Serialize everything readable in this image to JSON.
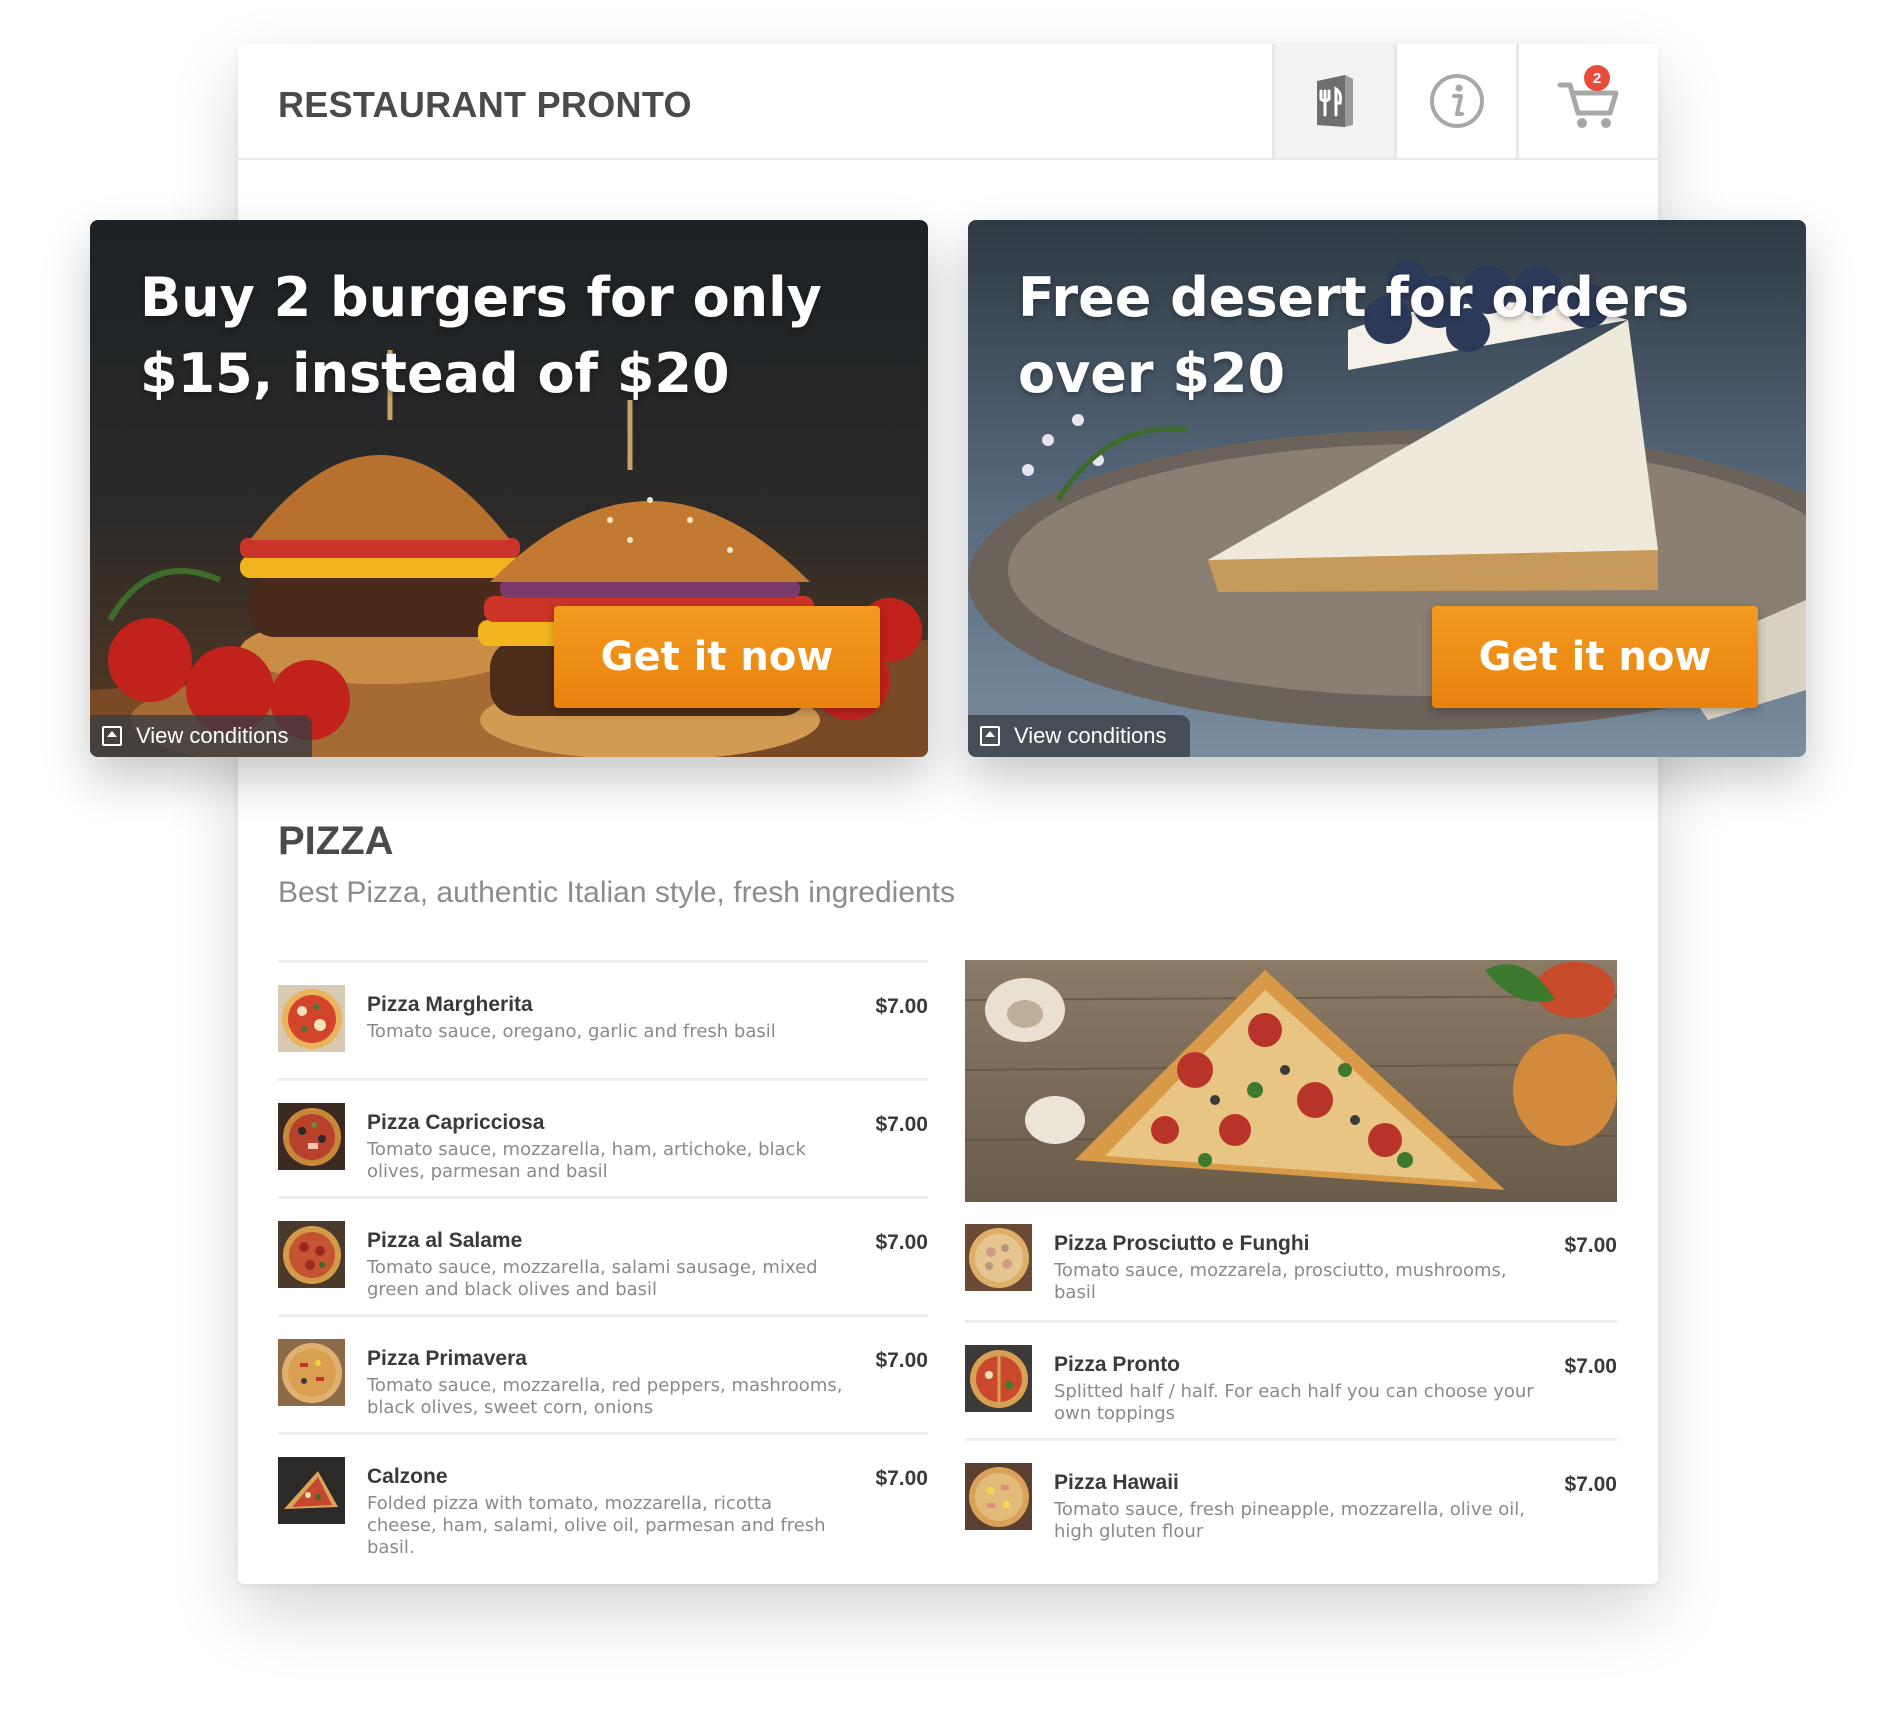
{
  "header": {
    "brand": "RESTAURANT PRONTO",
    "nav": [
      {
        "icon": "menu-book-icon",
        "active": true
      },
      {
        "icon": "info-icon",
        "active": false
      },
      {
        "icon": "cart-icon",
        "active": false
      }
    ],
    "cart_count": "2"
  },
  "promos": [
    {
      "title": "Buy 2 burgers for only $15, instead of $20",
      "cta": "Get it now",
      "conditions": "View conditions",
      "image": "burgers-photo"
    },
    {
      "title": "Free desert for orders over $20",
      "cta": "Get it now",
      "conditions": "View conditions",
      "image": "cheesecake-photo"
    }
  ],
  "section": {
    "title": "PIZZA",
    "subtitle": "Best Pizza, authentic Italian style, fresh ingredients"
  },
  "menu_left": [
    {
      "name": "Pizza Margherita",
      "desc": "Tomato sauce, oregano, garlic and fresh basil",
      "price": "$7.00"
    },
    {
      "name": "Pizza Capricciosa",
      "desc": "Tomato sauce, mozzarella, ham, artichoke, black olives, parmesan and basil",
      "price": "$7.00"
    },
    {
      "name": "Pizza al Salame",
      "desc": "Tomato sauce, mozzarella, salami sausage, mixed green and black olives and basil",
      "price": "$7.00"
    },
    {
      "name": "Pizza Primavera",
      "desc": "Tomato sauce, mozzarella, red peppers, mashrooms, black olives, sweet corn, onions",
      "price": "$7.00"
    },
    {
      "name": "Calzone",
      "desc": "Folded pizza with tomato, mozzarella, ricotta cheese, ham, salami, olive oil, parmesan and fresh basil.",
      "price": "$7.00"
    }
  ],
  "menu_right": [
    {
      "name": "Pizza Prosciutto e Funghi",
      "desc": "Tomato sauce, mozzarela, prosciutto, mushrooms, basil",
      "price": "$7.00"
    },
    {
      "name": "Pizza Pronto",
      "desc": "Splitted half / half. For each half you can choose your own toppings",
      "price": "$7.00"
    },
    {
      "name": "Pizza Hawaii",
      "desc": "Tomato sauce, fresh pineapple, mozzarella, olive oil, high gluten flour",
      "price": "$7.00"
    }
  ],
  "colors": {
    "accent": "#f0901a",
    "badge": "#e84c3d",
    "text_dark": "#4a4a4a",
    "text_muted": "#8a8a8a"
  }
}
